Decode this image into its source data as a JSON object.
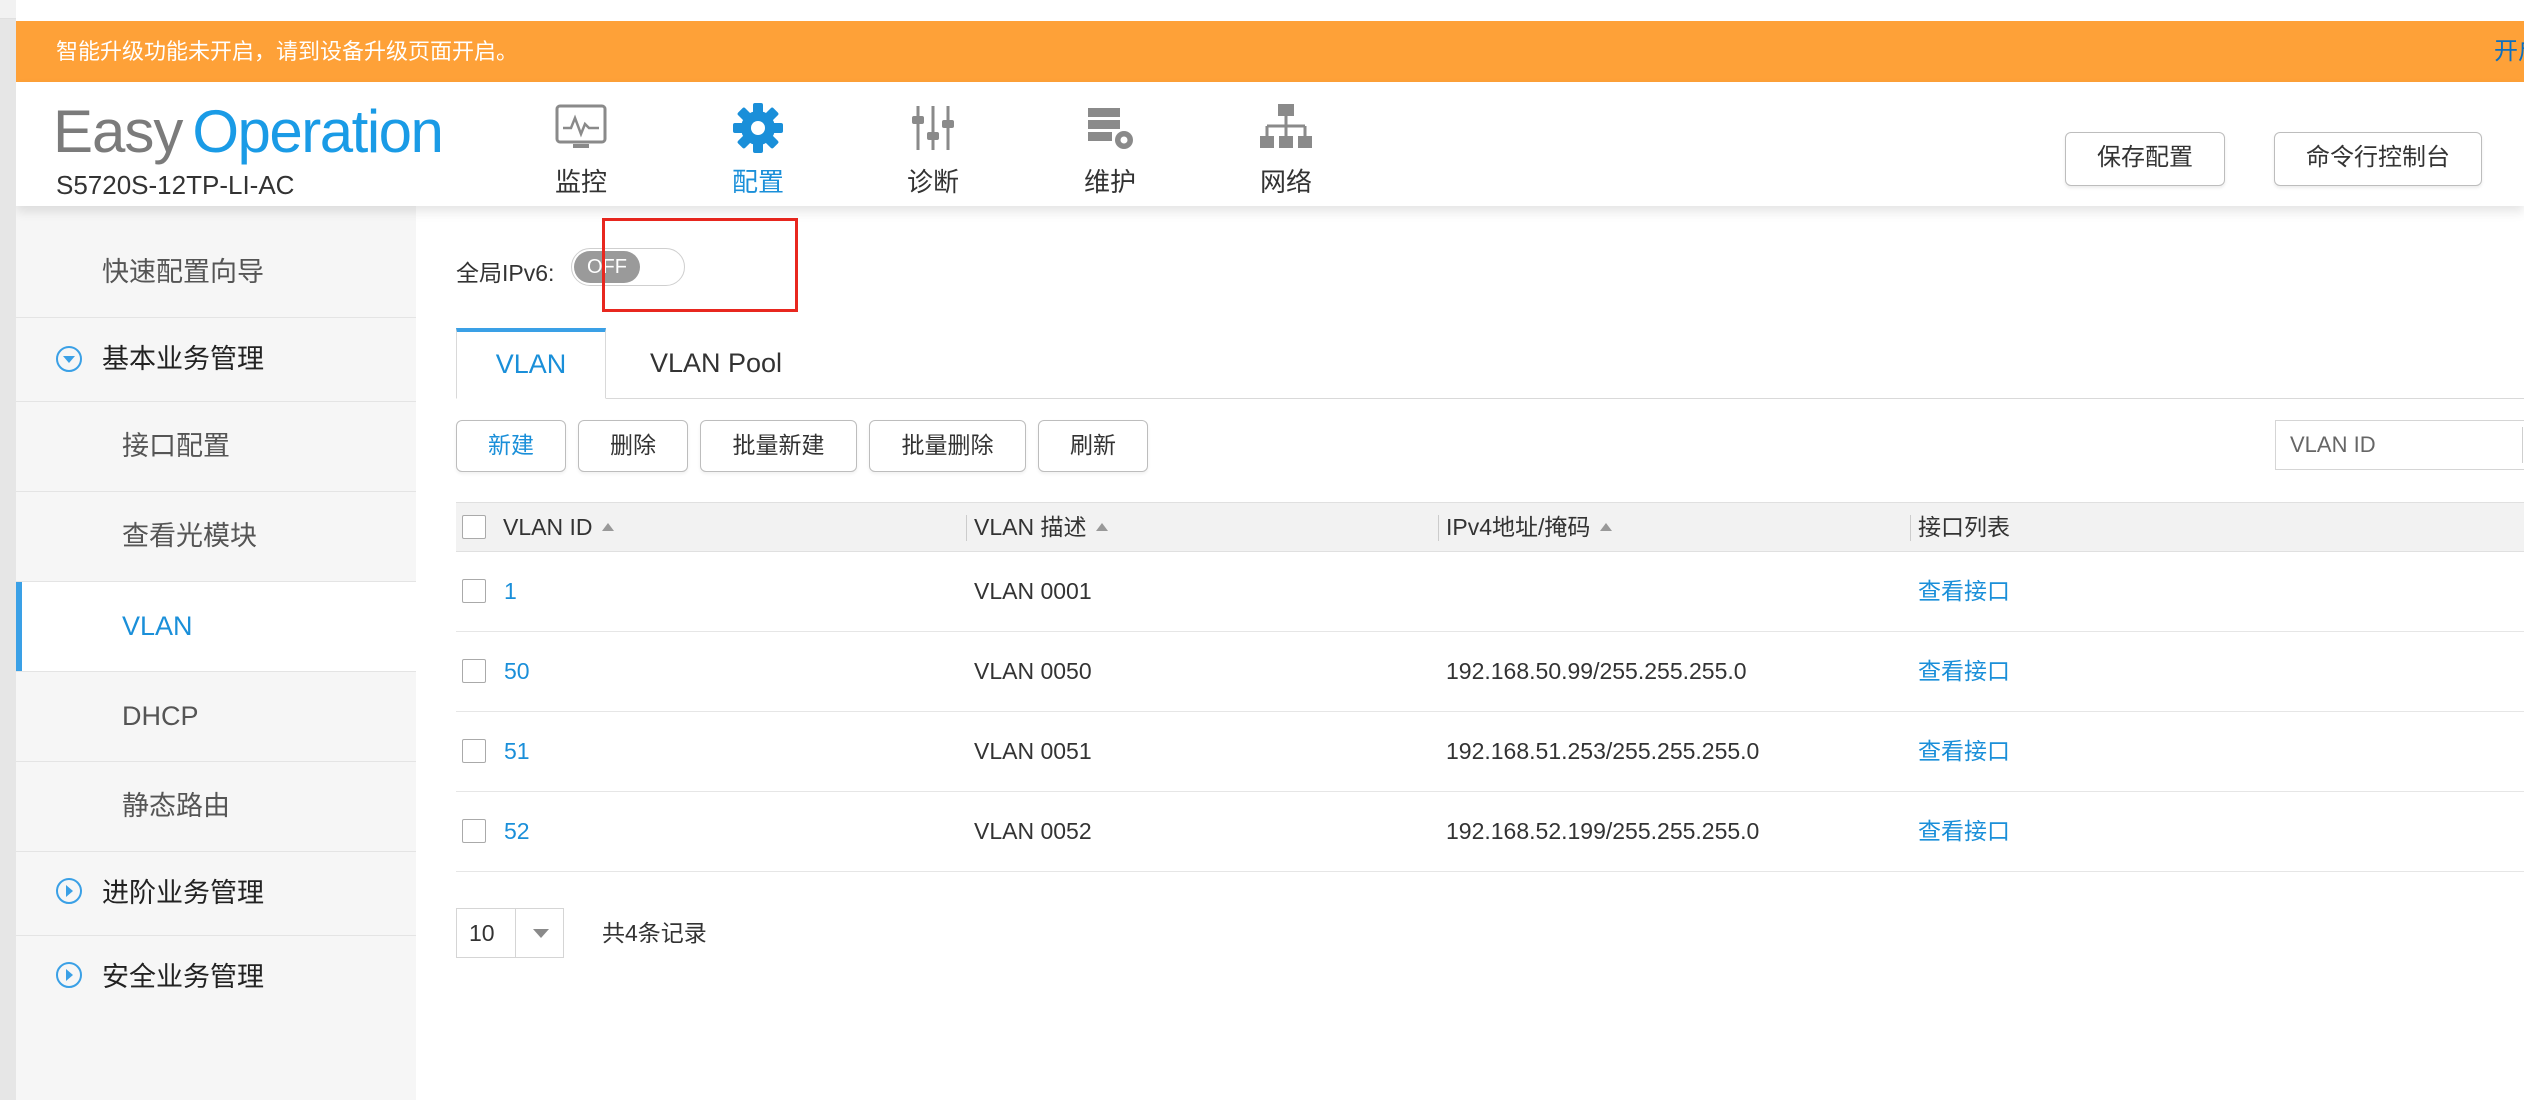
{
  "banner": {
    "text": "智能升级功能未开启，请到设备升级页面开启。",
    "link": "开启"
  },
  "header": {
    "logo_easy": "Easy",
    "logo_operation": "Operation",
    "model": "S5720S-12TP-LI-AC",
    "nav": [
      {
        "label": "监控",
        "icon": "monitor-icon"
      },
      {
        "label": "配置",
        "icon": "gear-icon",
        "active": true
      },
      {
        "label": "诊断",
        "icon": "sliders-icon"
      },
      {
        "label": "维护",
        "icon": "maintenance-icon"
      },
      {
        "label": "网络",
        "icon": "network-topology-icon"
      }
    ],
    "save_config": "保存配置",
    "cli_console": "命令行控制台"
  },
  "sidebar": {
    "items": [
      {
        "label": "快速配置向导"
      },
      {
        "label": "基本业务管理",
        "expanded": true
      },
      {
        "label": "接口配置"
      },
      {
        "label": "查看光模块"
      },
      {
        "label": "VLAN",
        "active": true
      },
      {
        "label": "DHCP"
      },
      {
        "label": "静态路由"
      },
      {
        "label": "进阶业务管理",
        "expanded": false
      },
      {
        "label": "安全业务管理",
        "expanded": false
      }
    ]
  },
  "main": {
    "ipv6_label": "全局IPv6:",
    "ipv6_toggle": "OFF",
    "tabs": [
      {
        "label": "VLAN",
        "active": true
      },
      {
        "label": "VLAN Pool"
      }
    ],
    "toolbar": {
      "new": "新建",
      "delete": "删除",
      "batch_new": "批量新建",
      "batch_delete": "批量删除",
      "refresh": "刷新"
    },
    "search_placeholder": "VLAN ID",
    "table": {
      "columns": [
        "VLAN ID",
        "VLAN 描述",
        "IPv4地址/掩码",
        "接口列表"
      ],
      "rows": [
        {
          "id": "1",
          "desc": "VLAN 0001",
          "ip": "",
          "action": "查看接口"
        },
        {
          "id": "50",
          "desc": "VLAN 0050",
          "ip": "192.168.50.99/255.255.255.0",
          "action": "查看接口"
        },
        {
          "id": "51",
          "desc": "VLAN 0051",
          "ip": "192.168.51.253/255.255.255.0",
          "action": "查看接口"
        },
        {
          "id": "52",
          "desc": "VLAN 0052",
          "ip": "192.168.52.199/255.255.255.0",
          "action": "查看接口"
        }
      ]
    },
    "pager": {
      "page_size": "10",
      "total": "共4条记录"
    }
  },
  "colors": {
    "banner": "#fea138",
    "accent": "#1a8fd9",
    "highlight_box": "#e8271f"
  }
}
